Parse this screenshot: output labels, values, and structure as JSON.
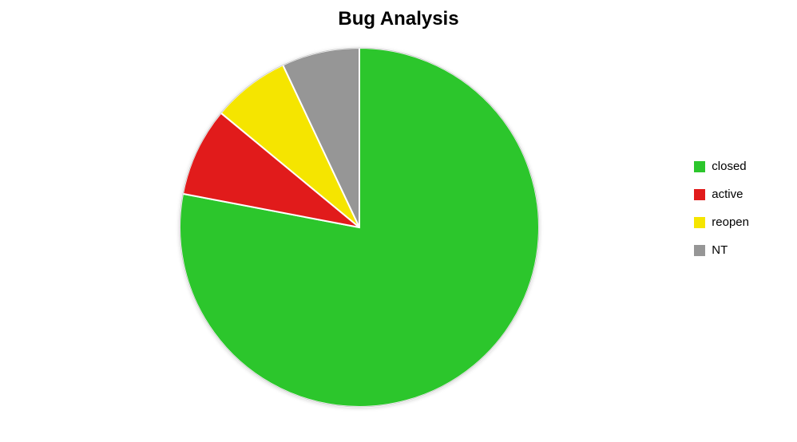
{
  "chart_data": {
    "type": "pie",
    "title": "Bug Analysis",
    "series": [
      {
        "name": "closed",
        "value": 78,
        "color": "#2CC62C"
      },
      {
        "name": "active",
        "value": 8,
        "color": "#E11B1B"
      },
      {
        "name": "reopen",
        "value": 7,
        "color": "#F5E500"
      },
      {
        "name": "NT",
        "value": 7,
        "color": "#969696"
      }
    ]
  }
}
